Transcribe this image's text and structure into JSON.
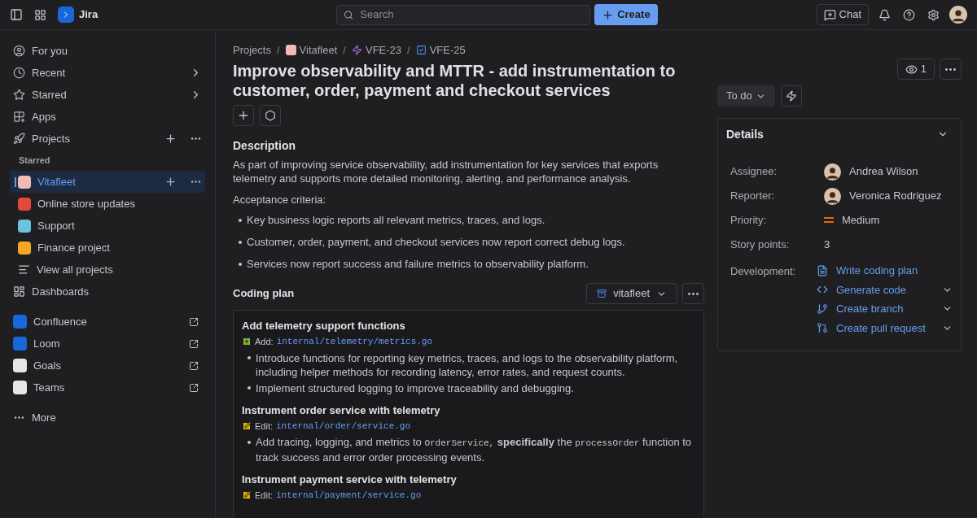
{
  "topbar": {
    "product": "Jira",
    "search": {
      "placeholder": "Search"
    },
    "create": "Create",
    "chat": "Chat"
  },
  "sidebar": {
    "items": [
      {
        "label": "For you",
        "kind": "plain"
      },
      {
        "label": "Recent",
        "kind": "chevron"
      },
      {
        "label": "Starred",
        "kind": "chevron"
      },
      {
        "label": "Apps",
        "kind": "plain"
      },
      {
        "label": "Projects",
        "kind": "actions"
      }
    ],
    "section_label": "Starred",
    "projects": [
      {
        "label": "Vitafleet",
        "selected": true,
        "color": "#f3b9b4"
      },
      {
        "label": "Online store updates",
        "selected": false,
        "color": "#e2483d"
      },
      {
        "label": "Support",
        "selected": false,
        "color": "#6cc3e0"
      },
      {
        "label": "Finance project",
        "selected": false,
        "color": "#f5a623"
      }
    ],
    "view_all": "View all projects",
    "dashboards": "Dashboards",
    "apps": [
      {
        "label": "Confluence",
        "color": "#1868db"
      },
      {
        "label": "Loom",
        "color": "#1868db"
      },
      {
        "label": "Goals",
        "color": "#e6e6e6"
      },
      {
        "label": "Teams",
        "color": "#e6e6e6"
      }
    ],
    "more": "More"
  },
  "issue": {
    "separator": "/",
    "breadcrumb": [
      {
        "label": "Projects"
      },
      {
        "label": "Vitafleet"
      },
      {
        "label": "VFE-23"
      },
      {
        "label": "VFE-25"
      }
    ],
    "title": "Improve observability and MTTR - add instrumentation to customer, order, payment and checkout services",
    "description_heading": "Description",
    "description": "As part of improving service observability, add instrumentation for key services that exports telemetry and supports more detailed monitoring, alerting, and performance analysis.",
    "criteria_label": "Acceptance criteria:",
    "criteria": [
      "Key business logic reports all relevant metrics, traces, and logs.",
      "Customer, order, payment, and checkout services now report correct debug logs.",
      "Services now report success and failure metrics to observability platform."
    ],
    "coding_plan": {
      "heading": "Coding plan",
      "repo": "vitafleet",
      "steps": [
        {
          "title": "Add telemetry support functions",
          "action": {
            "kind": "add",
            "label": "Add:"
          },
          "path": "internal/telemetry/metrics.go",
          "bullets": [
            [
              {
                "kind": "text",
                "text": "Introduce functions for reporting key metrics, traces, and logs to the observability platform, including helper methods for recording latency, error rates, and request counts."
              }
            ],
            [
              {
                "kind": "text",
                "text": "Implement structured logging to improve traceability and debugging."
              }
            ]
          ]
        },
        {
          "title": "Instrument order service with telemetry",
          "action": {
            "kind": "edit",
            "label": "Edit:"
          },
          "path": "internal/order/service.go",
          "bullets": [
            [
              {
                "kind": "text",
                "text": "Add tracing, logging, and metrics to "
              },
              {
                "kind": "code",
                "text": "OrderService,"
              },
              {
                "kind": "text",
                "text": " **specifically** the "
              },
              {
                "kind": "code",
                "text": "processOrder"
              },
              {
                "kind": "text",
                "text": " function to track success and error order processing events."
              }
            ]
          ]
        },
        {
          "title": "Instrument payment service with telemetry",
          "action": {
            "kind": "edit",
            "label": "Edit:"
          },
          "path": "internal/payment/service.go"
        }
      ]
    }
  },
  "side": {
    "watchers": "1",
    "status": "To do",
    "details_heading": "Details",
    "fields": [
      {
        "label": "Assignee:",
        "kind": "person",
        "value": "Andrea Wilson"
      },
      {
        "label": "Reporter:",
        "kind": "person",
        "value": "Veronica Rodriguez"
      },
      {
        "label": "Priority:",
        "kind": "priority",
        "value": "Medium"
      },
      {
        "label": "Story points:",
        "kind": "text",
        "value": "3"
      }
    ],
    "development_label": "Development:",
    "development": [
      {
        "label": "Write coding plan",
        "dropdown": false
      },
      {
        "label": "Generate code",
        "dropdown": true
      },
      {
        "label": "Create branch",
        "dropdown": true
      },
      {
        "label": "Create pull request",
        "dropdown": true
      }
    ]
  }
}
